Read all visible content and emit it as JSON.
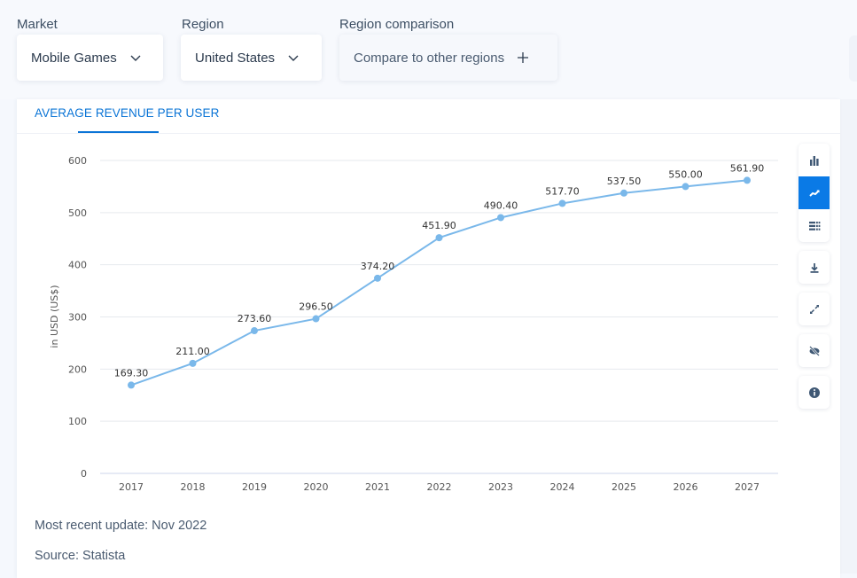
{
  "filters": {
    "market": {
      "label": "Market",
      "value": "Mobile Games",
      "icon": "chevron-down-icon"
    },
    "region": {
      "label": "Region",
      "value": "United States",
      "icon": "chevron-down-icon"
    },
    "comparison": {
      "label": "Region comparison",
      "value": "Compare to other regions",
      "icon": "plus-icon"
    }
  },
  "card": {
    "tab_label": "AVERAGE REVENUE PER USER"
  },
  "tools": [
    {
      "name": "bar-chart-icon",
      "active": false
    },
    {
      "name": "line-chart-icon",
      "active": true
    },
    {
      "name": "table-icon",
      "active": false
    },
    {
      "name": "download-icon",
      "active": false
    },
    {
      "name": "expand-icon",
      "active": false
    },
    {
      "name": "hide-icon",
      "active": false
    },
    {
      "name": "info-icon",
      "active": false
    }
  ],
  "colors": {
    "accent": "#0a74d6",
    "line": "#7ab8ea",
    "grid": "#e6e9ee",
    "axis_text": "#555555"
  },
  "chart_data": {
    "type": "line",
    "title": "Average Revenue per User",
    "xlabel": "",
    "ylabel": "in USD (US$)",
    "categories": [
      "2017",
      "2018",
      "2019",
      "2020",
      "2021",
      "2022",
      "2023",
      "2024",
      "2025",
      "2026",
      "2027"
    ],
    "series": [
      {
        "name": "Average Revenue per User",
        "values": [
          169.3,
          211.0,
          273.6,
          296.5,
          374.2,
          451.9,
          490.4,
          517.7,
          537.5,
          550.0,
          561.9
        ]
      }
    ],
    "data_labels": [
      "169.30",
      "211.00",
      "273.60",
      "296.50",
      "374.20",
      "451.90",
      "490.40",
      "517.70",
      "537.50",
      "550.00",
      "561.90"
    ],
    "ylim": [
      0,
      600
    ],
    "yticks": [
      0,
      100,
      200,
      300,
      400,
      500,
      600
    ],
    "grid": true,
    "legend": "none"
  },
  "footer": {
    "update": "Most recent update: Nov 2022",
    "source": "Source: Statista"
  }
}
